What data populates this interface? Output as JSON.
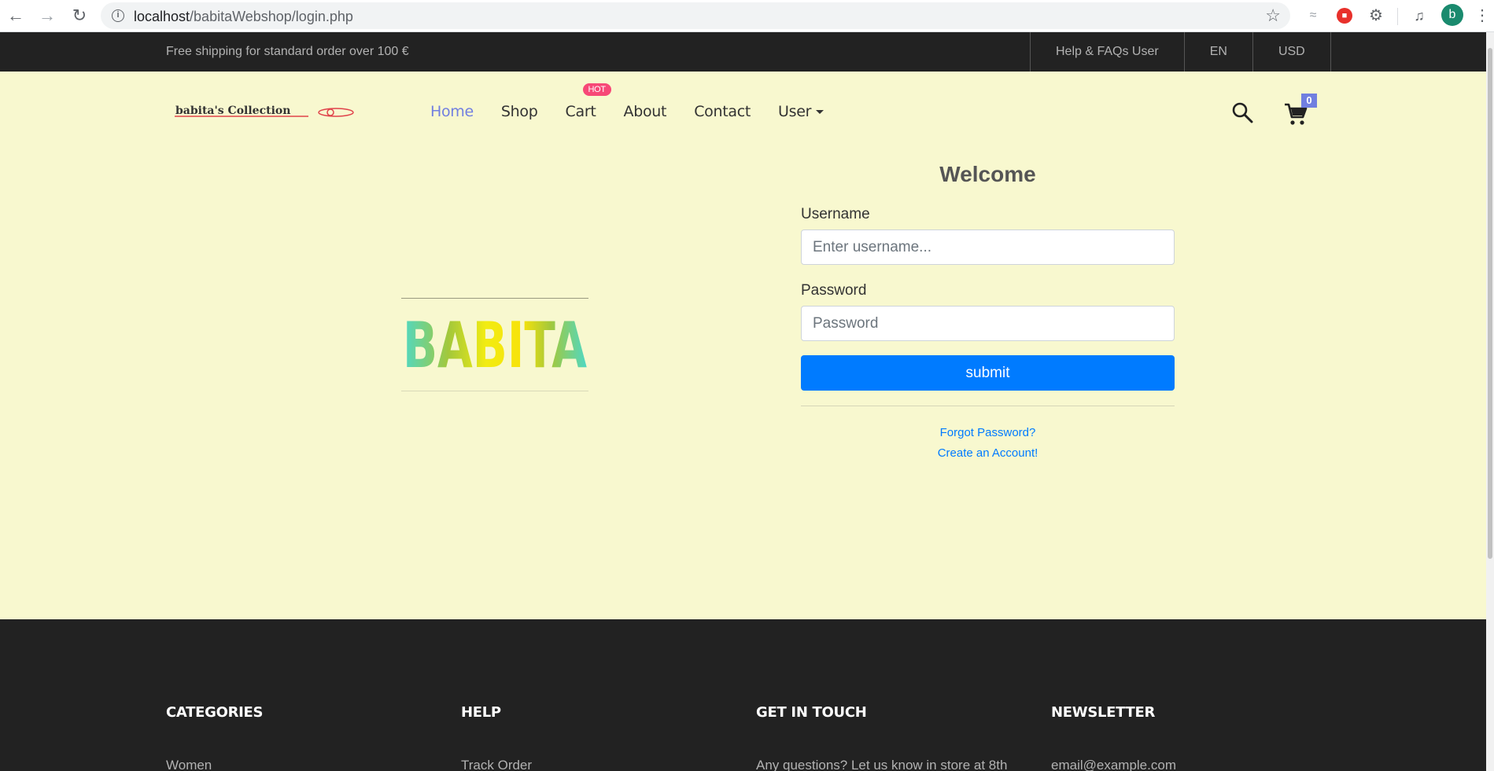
{
  "browser": {
    "url_host": "localhost",
    "url_path": "/babitaWebshop/login.php",
    "profile_initial": "b"
  },
  "topbar": {
    "promo": "Free shipping for standard order over 100 €",
    "links": [
      "Help & FAQs User",
      "EN",
      "USD"
    ]
  },
  "header": {
    "logo_text": "babita's Collection",
    "nav": [
      {
        "label": "Home",
        "active": true
      },
      {
        "label": "Shop"
      },
      {
        "label": "Cart",
        "badge": "HOT"
      },
      {
        "label": "About"
      },
      {
        "label": "Contact"
      },
      {
        "label": "User",
        "dropdown": true
      }
    ],
    "cart_count": "0"
  },
  "brand_image_text": "BABITA",
  "login": {
    "title": "Welcome",
    "username_label": "Username",
    "username_placeholder": "Enter username...",
    "password_label": "Password",
    "password_placeholder": "Password",
    "submit_label": "submit",
    "forgot_link": "Forgot Password?",
    "create_link": "Create an Account!"
  },
  "footer": {
    "columns": [
      {
        "title": "CATEGORIES",
        "first_item": "Women"
      },
      {
        "title": "HELP",
        "first_item": "Track Order"
      },
      {
        "title": "GET IN TOUCH",
        "first_item": "Any questions? Let us know in store at 8th"
      },
      {
        "title": "NEWSLETTER",
        "first_item": "email@example.com"
      }
    ]
  },
  "colors": {
    "page_background": "#f8f8cf",
    "topbar_background": "#222222",
    "accent": "#717fe0",
    "hot_badge": "#f74877",
    "primary_button": "#007bff"
  }
}
